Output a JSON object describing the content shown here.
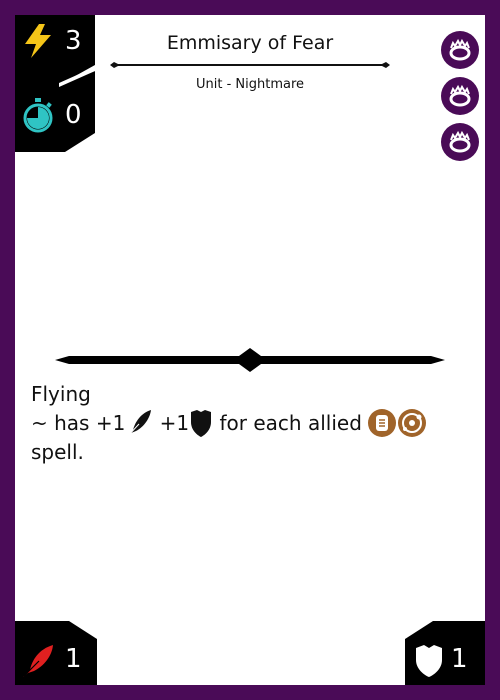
{
  "card": {
    "name": "Emmisary of Fear",
    "type_line": "Unit - Nightmare",
    "cost": {
      "icon": "lightning-icon",
      "value": "3"
    },
    "delay": {
      "icon": "stopwatch-icon",
      "value": "0"
    },
    "attack": {
      "icon": "feather-quill-icon",
      "value": "1"
    },
    "defense": {
      "icon": "shield-icon",
      "value": "1"
    },
    "sigils": [
      "void-ring-sigil-icon",
      "void-ring-sigil-icon",
      "void-ring-sigil-icon"
    ],
    "rules": {
      "keyword": "Flying",
      "line2_prefix": "~ has +1",
      "line2_plus": " +1",
      "line2_suffix": " for each allied ",
      "line3": "spell.",
      "line2_icons": [
        "feather-icon",
        "shield-icon",
        "scroll-token-icon",
        "orbit-token-icon"
      ]
    }
  },
  "colors": {
    "frame": "#4a0b57",
    "panel": "#000000",
    "lightning": "#f5c518",
    "stopwatch": "#2fc4c4",
    "attack": "#e02020",
    "token": "#a0642a"
  }
}
